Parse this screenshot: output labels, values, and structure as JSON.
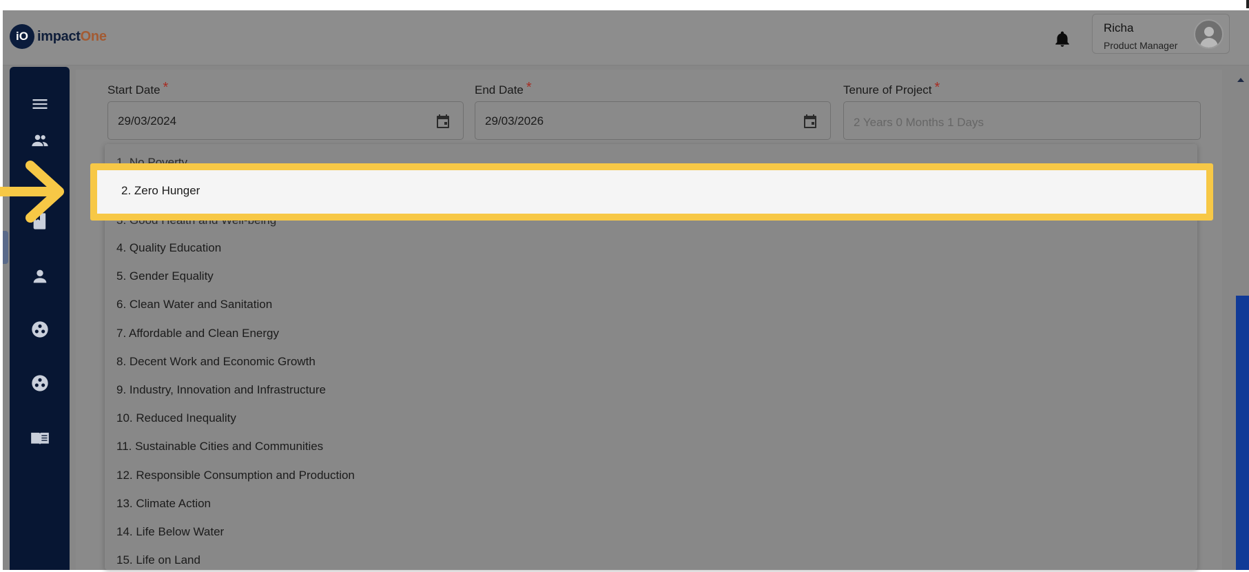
{
  "header": {
    "logo_badge": "iO",
    "logo_text_main": "impact",
    "logo_text_accent": "One",
    "user": {
      "name": "Richa",
      "role": "Product Manager"
    }
  },
  "sidebar": {
    "icons": [
      "menu-icon",
      "people-icon",
      "book-icon",
      "person-icon",
      "groups-icon",
      "groups-alt-icon",
      "open-book-icon"
    ]
  },
  "form": {
    "start_date": {
      "label": "Start Date",
      "required_mark": "*",
      "value": "29/03/2024"
    },
    "end_date": {
      "label": "End Date",
      "required_mark": "*",
      "value": "29/03/2026"
    },
    "tenure": {
      "label": "Tenure of Project",
      "required_mark": "*",
      "placeholder": "2 Years 0 Months 1 Days"
    }
  },
  "dropdown": {
    "cut_top": "1. No Poverty",
    "highlighted": "2. Zero Hunger",
    "cut_under_highlight": "3. Good Health and Well-being",
    "options": [
      "4. Quality Education",
      "5. Gender Equality",
      "6. Clean Water and Sanitation",
      "7. Affordable and Clean Energy",
      "8. Decent Work and Economic Growth",
      "9. Industry, Innovation and Infrastructure",
      "10. Reduced Inequality",
      "11. Sustainable Cities and Communities",
      "12. Responsible Consumption and Production",
      "13. Climate Action",
      "14. Life Below Water",
      "15. Life on Land"
    ]
  },
  "colors": {
    "highlight": "#f7c846",
    "sidebar": "#071633",
    "accent_orange": "#a35b33",
    "scroll_thumb": "#103a97"
  }
}
